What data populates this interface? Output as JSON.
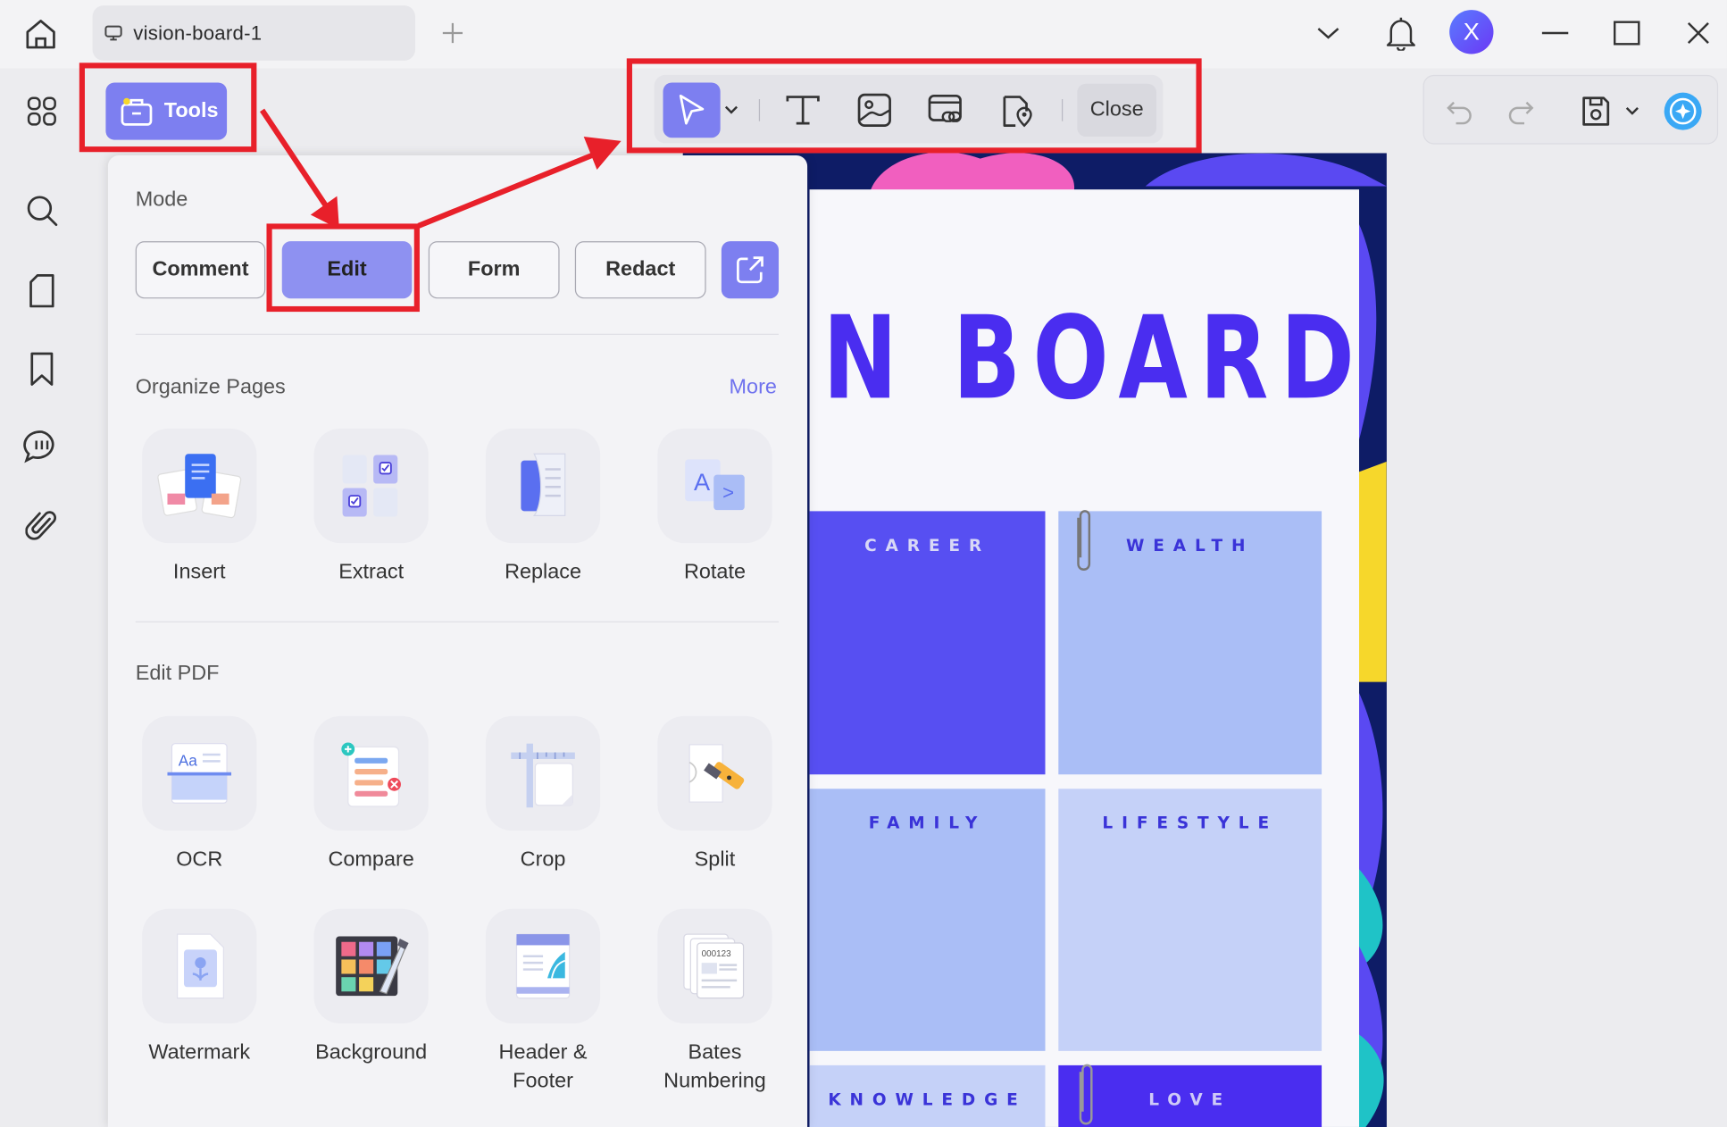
{
  "titlebar": {
    "tab_title": "vision-board-1",
    "avatar_initial": "X"
  },
  "toolbar": {
    "tools_label": "Tools",
    "close_label": "Close"
  },
  "panel": {
    "mode_heading": "Mode",
    "modes": [
      "Comment",
      "Edit",
      "Form",
      "Redact"
    ],
    "organize_heading": "Organize Pages",
    "more_label": "More",
    "organize_tools": [
      "Insert",
      "Extract",
      "Replace",
      "Rotate"
    ],
    "edit_heading": "Edit PDF",
    "edit_tools": [
      "OCR",
      "Compare",
      "Crop",
      "Split",
      "Watermark",
      "Background",
      "Header & Footer",
      "Bates Numbering"
    ]
  },
  "document": {
    "title_fragment": "N BOARD",
    "cells": [
      "CAREER",
      "WEALTH",
      "FAMILY",
      "LIFESTYLE",
      "KNOWLEDGE",
      "LOVE"
    ]
  },
  "colors": {
    "accent": "#7d7ff0",
    "annotation_red": "#e8202a",
    "doc_purple": "#4a2df0"
  }
}
